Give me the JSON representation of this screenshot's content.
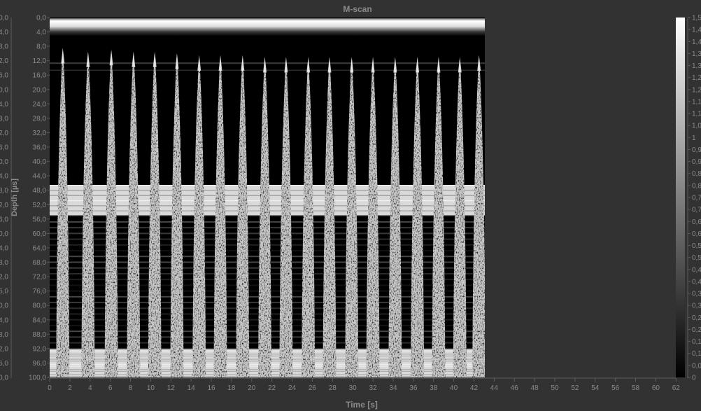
{
  "chart_data": {
    "type": "heatmap",
    "title": "M-scan",
    "xlabel": "Time [s]",
    "ylabel": "Depth [µs]",
    "xlim": [
      0,
      62
    ],
    "ylim": [
      0,
      100
    ],
    "x_ticks": [
      "0",
      "2",
      "4",
      "6",
      "8",
      "10",
      "12",
      "14",
      "16",
      "18",
      "20",
      "22",
      "24",
      "26",
      "28",
      "30",
      "32",
      "34",
      "36",
      "38",
      "40",
      "42",
      "44",
      "46",
      "48",
      "50",
      "52",
      "54",
      "56",
      "58",
      "60",
      "62"
    ],
    "y_ticks": [
      "0,0",
      "4,0",
      "8,0",
      "12,0",
      "16,0",
      "20,0",
      "24,0",
      "28,0",
      "32,0",
      "36,0",
      "40,0",
      "44,0",
      "48,0",
      "52,0",
      "56,0",
      "60,0",
      "64,0",
      "68,0",
      "72,0",
      "76,0",
      "80,0",
      "84,0",
      "88,0",
      "92,0",
      "96,0",
      "100,0"
    ],
    "data_extent_time": [
      0,
      43.1
    ],
    "colorbar": {
      "colormap": "grayscale",
      "range": [
        0,
        1.5
      ],
      "ticks": [
        "0",
        "0,05",
        "0,1",
        "0,15",
        "0,2",
        "0,25",
        "0,3",
        "0,35",
        "0,4",
        "0,45",
        "0,5",
        "0,55",
        "0,6",
        "0,65",
        "0,7",
        "0,75",
        "0,8",
        "0,85",
        "0,9",
        "0,95",
        "1",
        "1,05",
        "1,1",
        "1,15",
        "1,2",
        "1,25",
        "1,3",
        "1,35",
        "1,4",
        "1,45",
        "1,5"
      ]
    },
    "bright_bands_depth": [
      [
        1,
        4
      ],
      [
        46.5,
        55
      ],
      [
        92,
        100
      ]
    ],
    "pulse_times": [
      1.3,
      3.8,
      6.1,
      8.3,
      10.4,
      12.6,
      14.8,
      16.9,
      19.1,
      21.3,
      23.4,
      25.6,
      27.7,
      29.9,
      32.0,
      34.2,
      36.4,
      38.5,
      40.6,
      42.5
    ],
    "pulse_top_depth": [
      8.5,
      9.5,
      9.0,
      9.5,
      9.5,
      10.0,
      10.5,
      10.5,
      10.5,
      11.0,
      11.0,
      11.0,
      11.0,
      11.0,
      11.0,
      11.0,
      11.0,
      11.0,
      11.0,
      10.5
    ],
    "grid": false,
    "legend": "colorbar-right"
  }
}
